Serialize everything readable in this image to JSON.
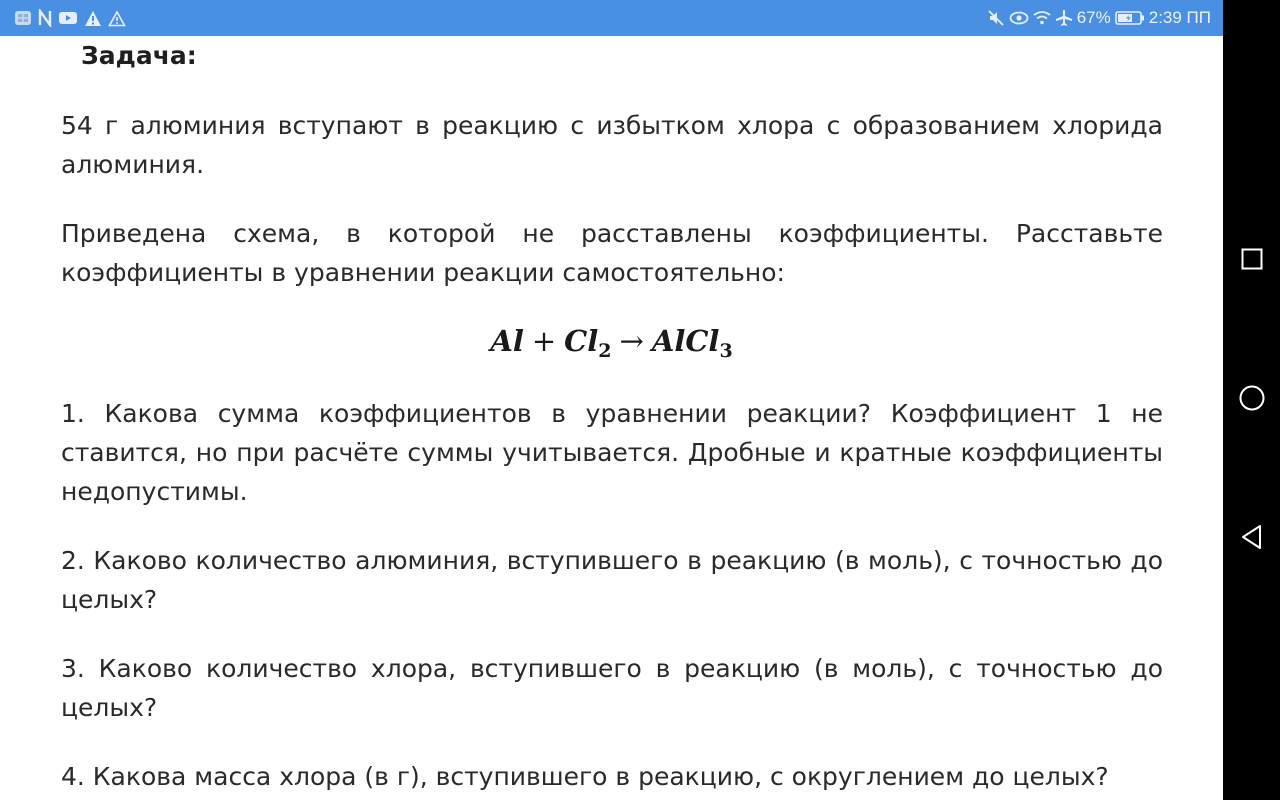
{
  "status_bar": {
    "left_icons": [
      "screenshot-icon",
      "n-app-icon",
      "youtube-icon",
      "warning-icon",
      "warning-outline-icon"
    ],
    "right_icons": [
      "mute-icon",
      "eye-icon",
      "wifi-icon",
      "airplane-icon",
      "battery-icon"
    ],
    "battery_percent": "67%",
    "time": "2:39 ПП",
    "colors": {
      "background": "#4a90e2",
      "foreground": "#ffffff"
    }
  },
  "content": {
    "title": "Задача:",
    "paragraph_1": "54 г алюминия вступают в реакцию с избытком хлора с образованием хлорида алюминия.",
    "paragraph_2": "Приведена схема, в которой не расставлены коэффициенты. Расставьте коэффициенты в уравнении реакции самостоятельно:",
    "formula": {
      "reactant_1": "Al",
      "plus": "+",
      "reactant_2": "Cl",
      "reactant_2_sub": "2",
      "arrow": "→",
      "product": "AlCl",
      "product_sub": "3"
    },
    "question_1": "1. Какова сумма коэффициентов в уравнении реакции? Коэффициент 1 не ставится, но при расчёте суммы учитывается. Дробные и кратные коэффициенты недопустимы.",
    "question_2": "2. Каково количество алюминия, вступившего в реакцию (в моль), с точностью до целых?",
    "question_3": "3. Каково количество хлора, вступившего в реакцию (в моль), с точностью до целых?",
    "question_4": "4. Какова масса хлора (в г), вступившего в реакцию, с округлением до целых?"
  },
  "nav_bar": {
    "buttons": [
      "recent-apps-icon",
      "home-icon",
      "back-icon"
    ],
    "colors": {
      "background": "#000000",
      "icon": "#ffffff"
    }
  }
}
